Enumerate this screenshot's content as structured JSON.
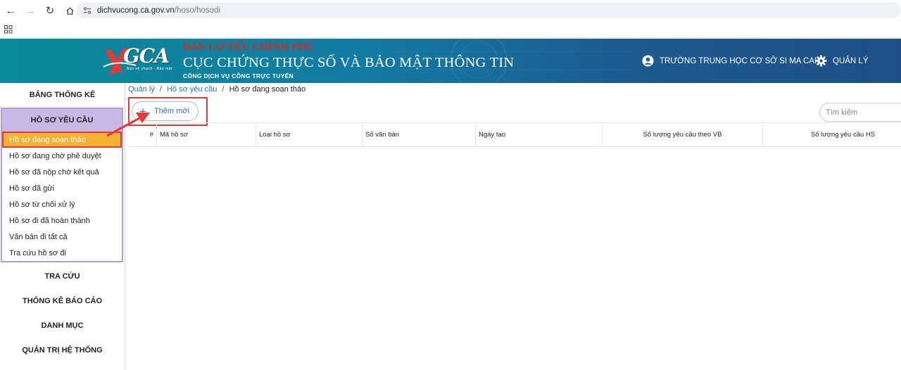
{
  "browser": {
    "url_domain": "dichvucong.ca.gov.vn",
    "url_path": "/hoso/hosodi"
  },
  "header": {
    "logo_text": "GCA",
    "logo_sub": "Bảo vệ nhanh - Bảo mật",
    "org_top": "BAN CƠ YẾU CHÍNH PHỦ",
    "org_main": "CỤC CHỨNG THỰC SỐ VÀ BẢO MẬT THÔNG TIN",
    "org_sub": "CỔNG DỊCH VỤ CÔNG TRỰC TUYẾN",
    "user_name": "TRƯỜNG TRUNG HỌC CƠ SỞ SI MA CAI",
    "admin_label": "QUẢN LÝ"
  },
  "sidebar": {
    "top_item": "BẢNG THỐNG KÊ",
    "group_label": "HỒ SƠ YÊU CẦU",
    "group_items": [
      "Hồ sơ đang soạn thảo",
      "Hồ sơ đang chờ phê duyệt",
      "Hồ sơ đã nộp chờ kết quả",
      "Hồ sơ đã gửi",
      "Hồ sơ từ chối xử lý",
      "Hồ sơ đi đã hoàn thành",
      "Văn bản đi tất cả",
      "Tra cứu hồ sơ đi"
    ],
    "bottom_items": [
      "TRA CỨU",
      "THỐNG KÊ BÁO CÁO",
      "DANH MỤC",
      "QUẢN TRỊ HỆ THỐNG"
    ]
  },
  "main": {
    "breadcrumb": [
      "Quản lý",
      "Hồ sơ yêu cầu",
      "Hồ sơ đang soạn thảo"
    ],
    "add_button": "Thêm mới",
    "search_placeholder": "Tìm kiếm",
    "table_headers": [
      "#",
      "Mã hồ sơ",
      "Loại hồ sơ",
      "Số văn bản",
      "Ngày tạo",
      "Số lượng yêu cầu theo VB",
      "Số lượng yêu cầu HS"
    ]
  },
  "colors": {
    "active_item": "#f3b234",
    "group_head": "#c9b8e6",
    "link": "#2f6fc7",
    "highlight": "#e53935",
    "org_top": "#e0251b"
  }
}
